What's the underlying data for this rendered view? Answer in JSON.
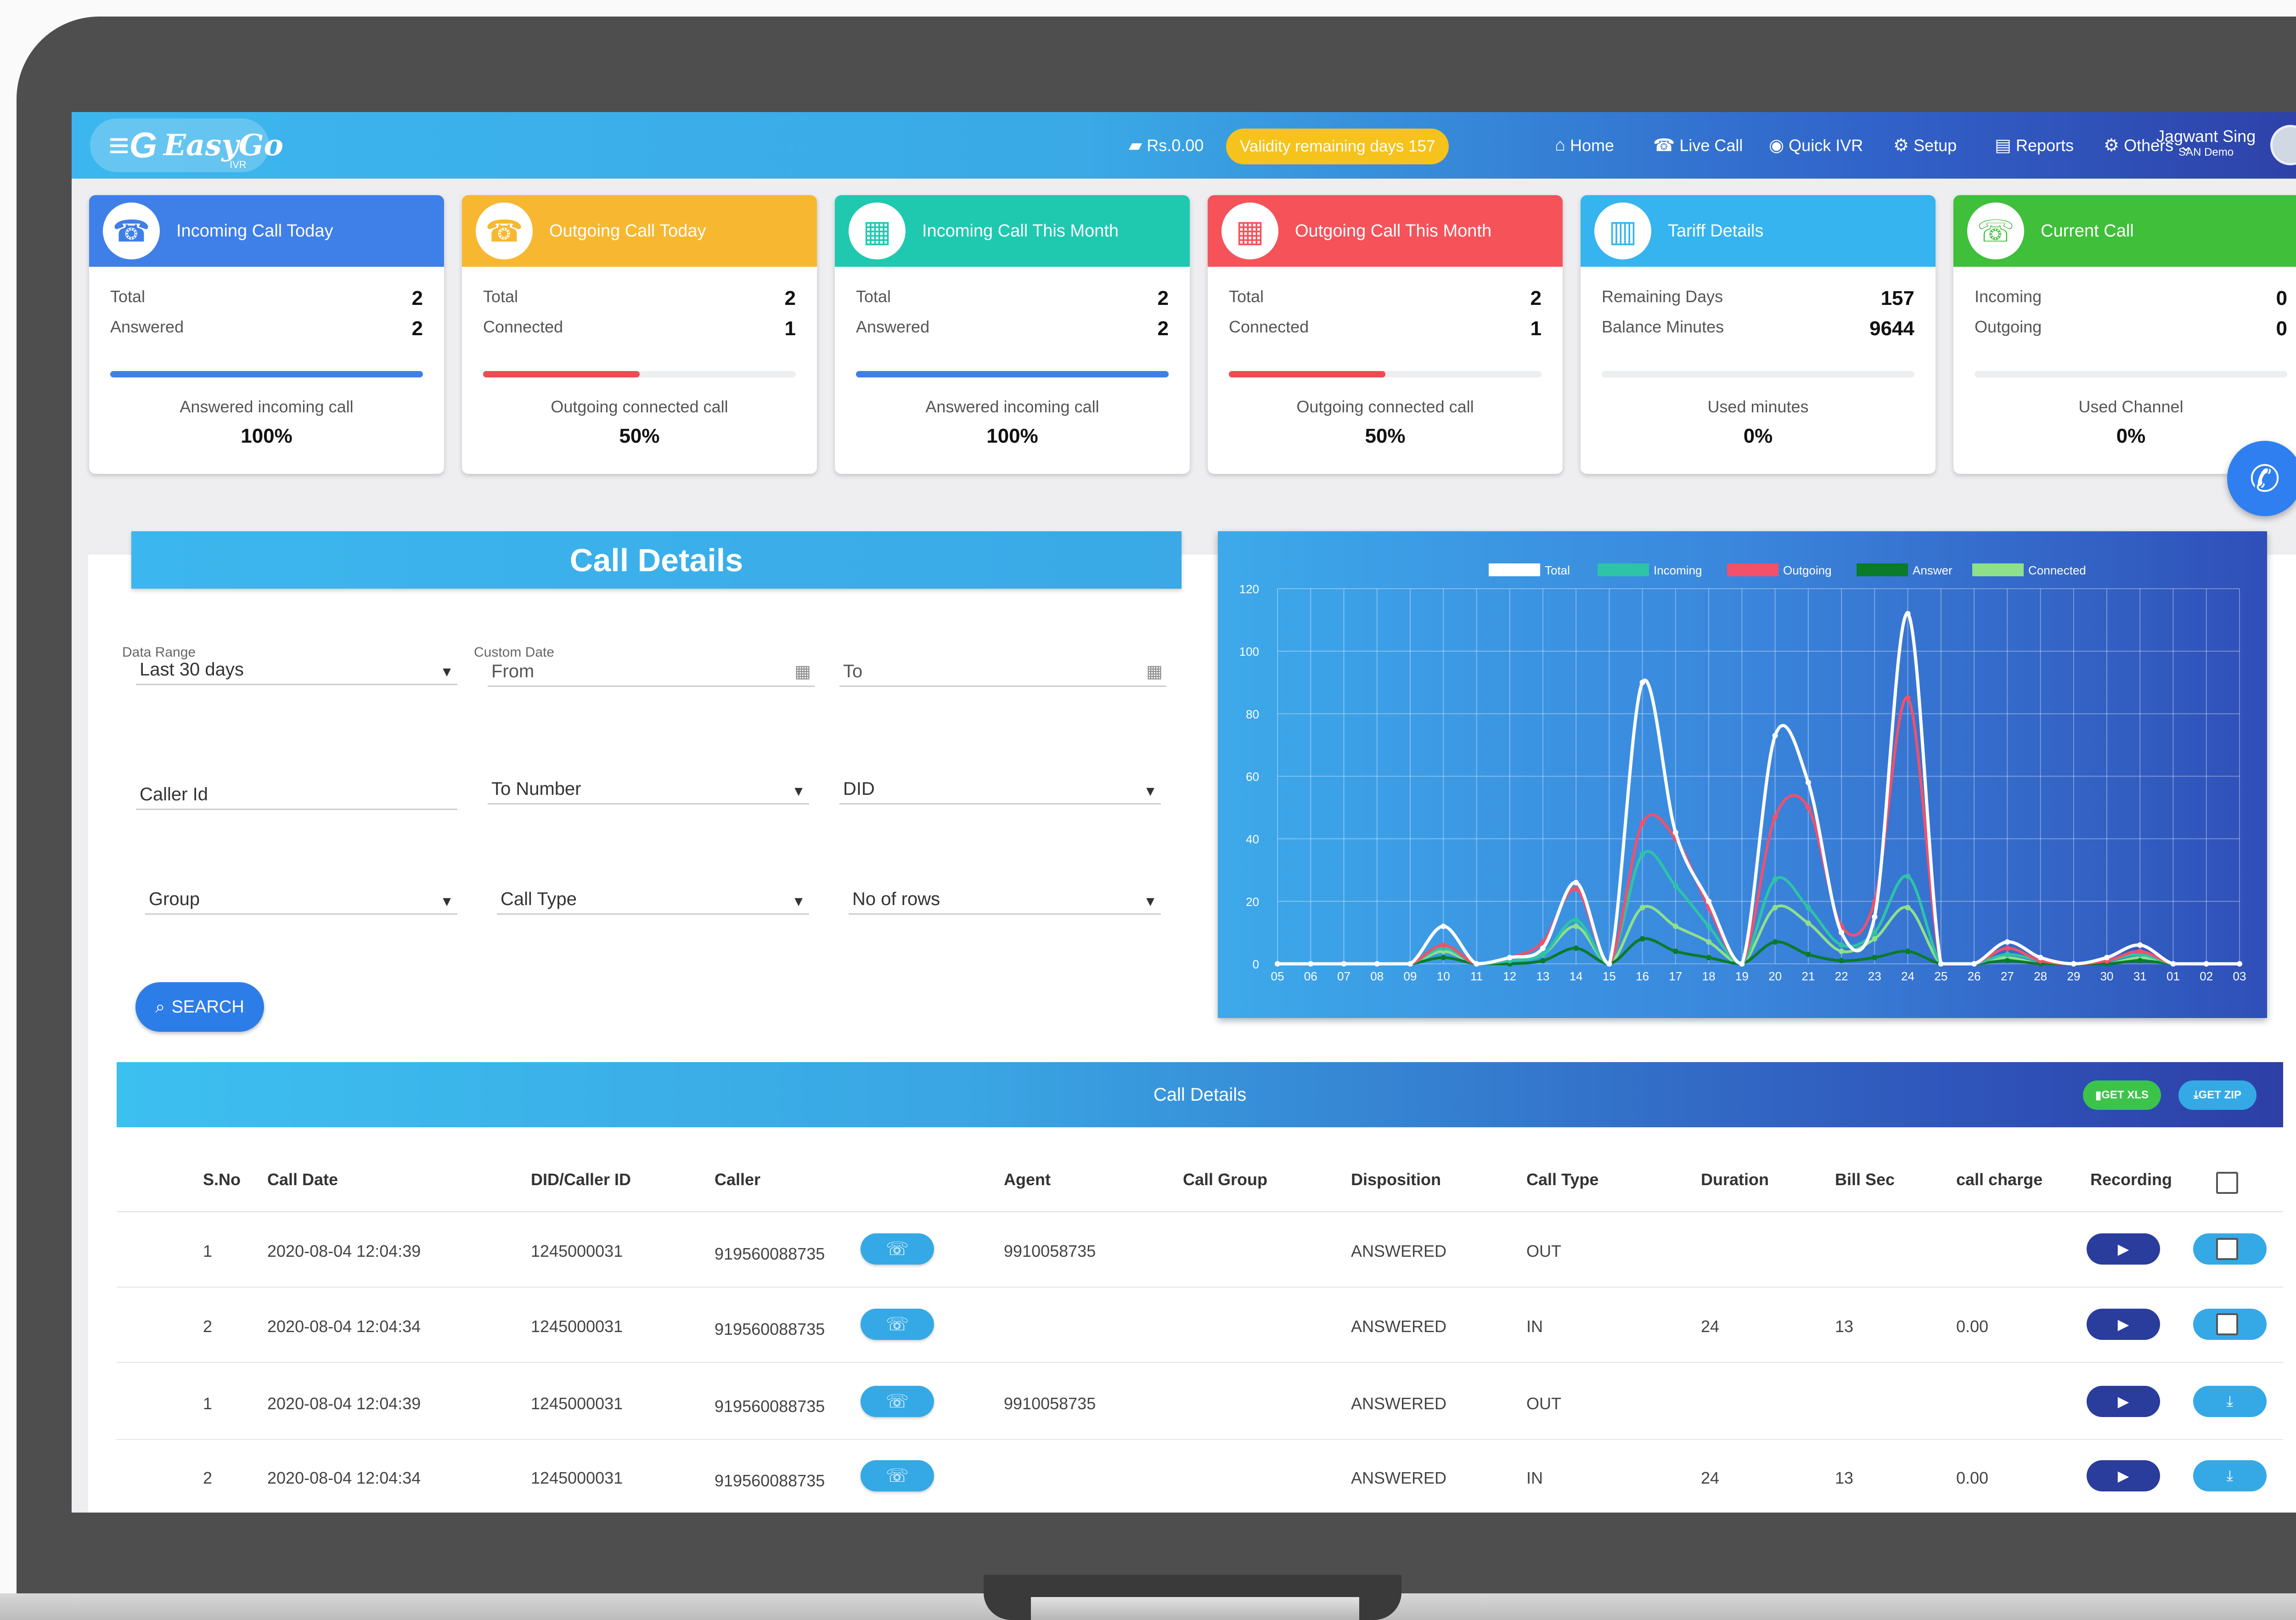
{
  "header": {
    "brand": "EasyGo",
    "brand_sub": "IVR",
    "balance": "Rs.0.00",
    "validity": "Validity remaining days 157",
    "nav": [
      "Home",
      "Live Call",
      "Quick IVR",
      "Setup",
      "Reports",
      "Others"
    ],
    "user_name": "Jagwant Sing",
    "user_role": "SAN Demo"
  },
  "cards": [
    {
      "title": "Incoming Call Today",
      "color": "#3f7fe8",
      "row1_label": "Total",
      "row1_value": "2",
      "row2_label": "Answered",
      "row2_value": "2",
      "progress": 1.0,
      "bar_color": "#3f7fe8",
      "footer_label": "Answered incoming call",
      "footer_value": "100%"
    },
    {
      "title": "Outgoing Call Today",
      "color": "#f7b731",
      "row1_label": "Total",
      "row1_value": "2",
      "row2_label": "Connected",
      "row2_value": "1",
      "progress": 0.5,
      "bar_color": "#ef4b52",
      "footer_label": "Outgoing connected call",
      "footer_value": "50%"
    },
    {
      "title": "Incoming Call This Month",
      "color": "#1ec9b0",
      "row1_label": "Total",
      "row1_value": "2",
      "row2_label": "Answered",
      "row2_value": "2",
      "progress": 1.0,
      "bar_color": "#3f7fe8",
      "footer_label": "Answered incoming call",
      "footer_value": "100%"
    },
    {
      "title": "Outgoing Call This Month",
      "color": "#f5525a",
      "row1_label": "Total",
      "row1_value": "2",
      "row2_label": "Connected",
      "row2_value": "1",
      "progress": 0.5,
      "bar_color": "#ef4b52",
      "footer_label": "Outgoing connected call",
      "footer_value": "50%"
    },
    {
      "title": "Tariff Details",
      "color": "#36b4ef",
      "row1_label": "Remaining Days",
      "row1_value": "157",
      "row2_label": "Balance Minutes",
      "row2_value": "9644",
      "progress": 0.0,
      "bar_color": "#36b4ef",
      "footer_label": "Used minutes",
      "footer_value": "0%"
    },
    {
      "title": "Current Call",
      "color": "#3fbf3a",
      "row1_label": "Incoming",
      "row1_value": "0",
      "row2_label": "Outgoing",
      "row2_value": "0",
      "progress": 0.0,
      "bar_color": "#3fbf3a",
      "footer_label": "Used Channel",
      "footer_value": "0%"
    }
  ],
  "filters": {
    "title": "Call Details",
    "data_range_label": "Data Range",
    "data_range_value": "Last 30 days",
    "custom_date_label": "Custom Date",
    "from_placeholder": "From",
    "to_placeholder": "To",
    "caller_id": "Caller Id",
    "to_number": "To Number",
    "did": "DID",
    "group": "Group",
    "call_type": "Call Type",
    "no_of_rows": "No of rows",
    "search_button": "SEARCH"
  },
  "chart_data": {
    "type": "line",
    "x": [
      "05",
      "06",
      "07",
      "08",
      "09",
      "10",
      "11",
      "12",
      "13",
      "14",
      "15",
      "16",
      "17",
      "18",
      "19",
      "20",
      "21",
      "22",
      "23",
      "24",
      "25",
      "26",
      "27",
      "28",
      "29",
      "30",
      "31",
      "01",
      "02",
      "03"
    ],
    "ylim": [
      0,
      120
    ],
    "yticks": [
      0,
      20,
      40,
      60,
      80,
      100,
      120
    ],
    "grid": true,
    "legend_position": "top",
    "series": [
      {
        "name": "Total",
        "color": "#ffffff",
        "values": [
          0,
          0,
          0,
          0,
          0,
          12,
          0,
          2,
          5,
          26,
          0,
          90,
          42,
          20,
          0,
          73,
          58,
          10,
          15,
          112,
          0,
          0,
          7,
          2,
          0,
          2,
          6,
          0,
          0,
          0
        ]
      },
      {
        "name": "Incoming",
        "color": "#2ec4a6",
        "values": [
          0,
          0,
          0,
          0,
          0,
          5,
          0,
          1,
          3,
          14,
          0,
          35,
          25,
          12,
          0,
          27,
          18,
          6,
          10,
          28,
          0,
          0,
          3,
          1,
          0,
          1,
          3,
          0,
          0,
          0
        ]
      },
      {
        "name": "Outgoing",
        "color": "#f2506b",
        "values": [
          0,
          0,
          0,
          0,
          0,
          6,
          0,
          2,
          7,
          24,
          0,
          45,
          40,
          18,
          0,
          47,
          50,
          12,
          20,
          85,
          0,
          0,
          5,
          1,
          0,
          1,
          4,
          0,
          0,
          0
        ]
      },
      {
        "name": "Answer",
        "color": "#0a7a2b",
        "values": [
          0,
          0,
          0,
          0,
          0,
          2,
          0,
          0,
          1,
          5,
          0,
          8,
          4,
          2,
          0,
          7,
          3,
          1,
          2,
          4,
          0,
          0,
          1,
          0,
          0,
          0,
          1,
          0,
          0,
          0
        ]
      },
      {
        "name": "Connected",
        "color": "#8ee08a",
        "values": [
          0,
          0,
          0,
          0,
          0,
          4,
          0,
          1,
          3,
          12,
          0,
          18,
          12,
          7,
          0,
          18,
          13,
          4,
          8,
          18,
          0,
          0,
          2,
          0,
          0,
          0,
          2,
          0,
          0,
          0
        ]
      }
    ]
  },
  "table": {
    "title": "Call Details",
    "get_xls": "GET XLS",
    "get_zip": "GET ZIP",
    "columns": [
      "S.No",
      "Call Date",
      "DID/Caller ID",
      "Caller",
      "Agent",
      "Call Group",
      "Disposition",
      "Call Type",
      "Duration",
      "Bill Sec",
      "call charge",
      "Recording"
    ],
    "rows": [
      {
        "sno": "1",
        "date": "2020-08-04 12:04:39",
        "did": "1245000031",
        "caller": "919560088735",
        "agent": "9910058735",
        "group": "",
        "disposition": "ANSWERED",
        "type": "OUT",
        "duration": "",
        "billsec": "",
        "charge": ""
      },
      {
        "sno": "2",
        "date": "2020-08-04 12:04:34",
        "did": "1245000031",
        "caller": "919560088735",
        "agent": "",
        "group": "",
        "disposition": "ANSWERED",
        "type": "IN",
        "duration": "24",
        "billsec": "13",
        "charge": "0.00"
      },
      {
        "sno": "1",
        "date": "2020-08-04 12:04:39",
        "did": "1245000031",
        "caller": "919560088735",
        "agent": "9910058735",
        "group": "",
        "disposition": "ANSWERED",
        "type": "OUT",
        "duration": "",
        "billsec": "",
        "charge": ""
      },
      {
        "sno": "2",
        "date": "2020-08-04 12:04:34",
        "did": "1245000031",
        "caller": "919560088735",
        "agent": "",
        "group": "",
        "disposition": "ANSWERED",
        "type": "IN",
        "duration": "24",
        "billsec": "13",
        "charge": "0.00"
      }
    ]
  }
}
